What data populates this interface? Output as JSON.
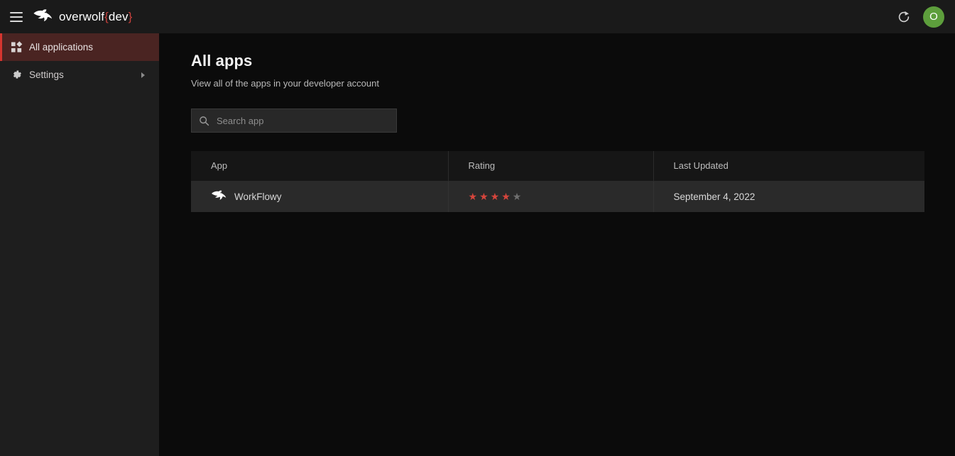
{
  "topbar": {
    "menu_icon": "hamburger-icon",
    "brand_name": "overwolf",
    "brand_tag_open": "{",
    "brand_tag_word": "dev",
    "brand_tag_close": "}",
    "refresh_icon": "refresh-icon",
    "avatar_initial": "O",
    "avatar_color": "#5d9e3c"
  },
  "sidebar": {
    "items": [
      {
        "label": "All applications",
        "icon": "apps-grid-icon",
        "active": true,
        "has_submenu": false
      },
      {
        "label": "Settings",
        "icon": "gear-icon",
        "active": false,
        "has_submenu": true
      }
    ],
    "active_accent_color": "#d6352f",
    "active_bg_color": "#4a2422"
  },
  "main": {
    "title": "All apps",
    "subtitle": "View all of the apps in your developer account",
    "search": {
      "placeholder": "Search app",
      "value": "",
      "icon": "search-icon"
    },
    "table": {
      "columns": [
        "App",
        "Rating",
        "Last Updated"
      ],
      "rows": [
        {
          "app_name": "WorkFlowy",
          "app_icon": "overwolf-wolf-icon",
          "rating": 4,
          "rating_max": 5,
          "last_updated": "September 4, 2022"
        }
      ],
      "star_filled_color": "#d6453c",
      "star_empty_color": "#6f6f6f"
    }
  }
}
